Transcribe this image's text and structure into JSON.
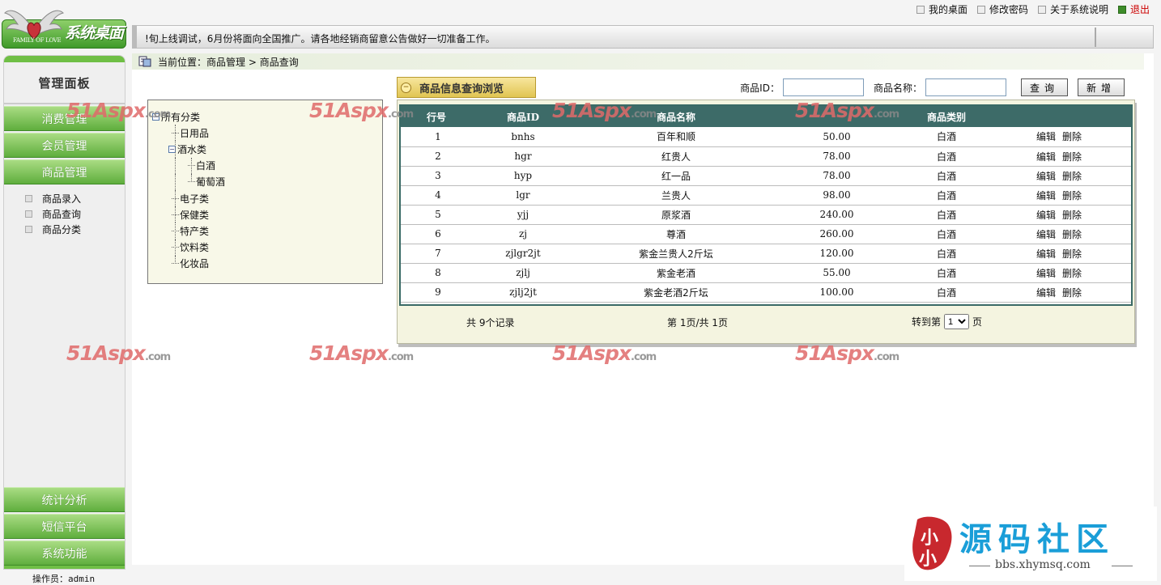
{
  "header": {
    "logo_title": "系统桌面",
    "logo_subtitle": "FAMILY OF LOVE",
    "top_links": [
      {
        "label": "我的桌面"
      },
      {
        "label": "修改密码"
      },
      {
        "label": "关于系统说明"
      },
      {
        "label": "退出"
      }
    ],
    "ticker": "!旬上线调试，6月份将面向全国推广。请各地经销商留意公告做好一切准备工作。"
  },
  "sidebar": {
    "title": "管理面板",
    "top_nav": [
      {
        "label": "消费管理"
      },
      {
        "label": "会员管理"
      },
      {
        "label": "商品管理"
      }
    ],
    "sub_nav": [
      {
        "label": "商品录入"
      },
      {
        "label": "商品查询"
      },
      {
        "label": "商品分类"
      }
    ],
    "bottom_nav": [
      {
        "label": "统计分析"
      },
      {
        "label": "短信平台"
      },
      {
        "label": "系统功能"
      }
    ],
    "operator": "操作员：admin"
  },
  "breadcrumb": {
    "prefix": "当前位置：",
    "path": "商品管理 > 商品查询"
  },
  "tree": {
    "root": "所有分类",
    "items": [
      {
        "label": "日用品"
      },
      {
        "label": "酒水类"
      },
      {
        "label": "白酒"
      },
      {
        "label": "葡萄酒"
      },
      {
        "label": "电子类"
      },
      {
        "label": "保健类"
      },
      {
        "label": "特产类"
      },
      {
        "label": "饮料类"
      },
      {
        "label": "化妆品"
      }
    ]
  },
  "panel": {
    "title": "商品信息查询浏览",
    "search": {
      "id_label": "商品ID：",
      "id_value": "",
      "name_label": "商品名称：",
      "name_value": "",
      "query_button": "查询",
      "add_button": "新增"
    },
    "columns": [
      "行号",
      "商品ID",
      "商品名称",
      "",
      "商品类别",
      ""
    ],
    "rows": [
      {
        "no": "1",
        "id": "bnhs",
        "name": "百年和顺",
        "price": "50.00",
        "category": "白酒"
      },
      {
        "no": "2",
        "id": "hgr",
        "name": "红贵人",
        "price": "78.00",
        "category": "白酒"
      },
      {
        "no": "3",
        "id": "hyp",
        "name": "红一品",
        "price": "78.00",
        "category": "白酒"
      },
      {
        "no": "4",
        "id": "lgr",
        "name": "兰贵人",
        "price": "98.00",
        "category": "白酒"
      },
      {
        "no": "5",
        "id": "yjj",
        "name": "原浆酒",
        "price": "240.00",
        "category": "白酒"
      },
      {
        "no": "6",
        "id": "zj",
        "name": "尊酒",
        "price": "260.00",
        "category": "白酒"
      },
      {
        "no": "7",
        "id": "zjlgr2jt",
        "name": "紫金兰贵人2斤坛",
        "price": "120.00",
        "category": "白酒"
      },
      {
        "no": "8",
        "id": "zjlj",
        "name": "紫金老酒",
        "price": "55.00",
        "category": "白酒"
      },
      {
        "no": "9",
        "id": "zjlj2jt",
        "name": "紫金老酒2斤坛",
        "price": "100.00",
        "category": "白酒"
      }
    ],
    "row_actions": {
      "edit": "编辑",
      "delete": "删除"
    },
    "pager": {
      "total": "共 9个记录",
      "page_info": "第 1页/共 1页",
      "goto_label": "转到第",
      "goto_value": "1",
      "page_suffix": "页"
    }
  },
  "watermark": {
    "text": "51Aspx",
    "suffix": ".com"
  },
  "brand": {
    "seal_text": "小小",
    "title": "源码社区",
    "url": "bbs.xhymsq.com"
  },
  "colors": {
    "green_accent": "#5fae3d",
    "grid_header": "#3d6b68",
    "tab_gold": "#e1c552",
    "logout_red": "#cc0000",
    "brand_blue": "#1a9ed8"
  }
}
